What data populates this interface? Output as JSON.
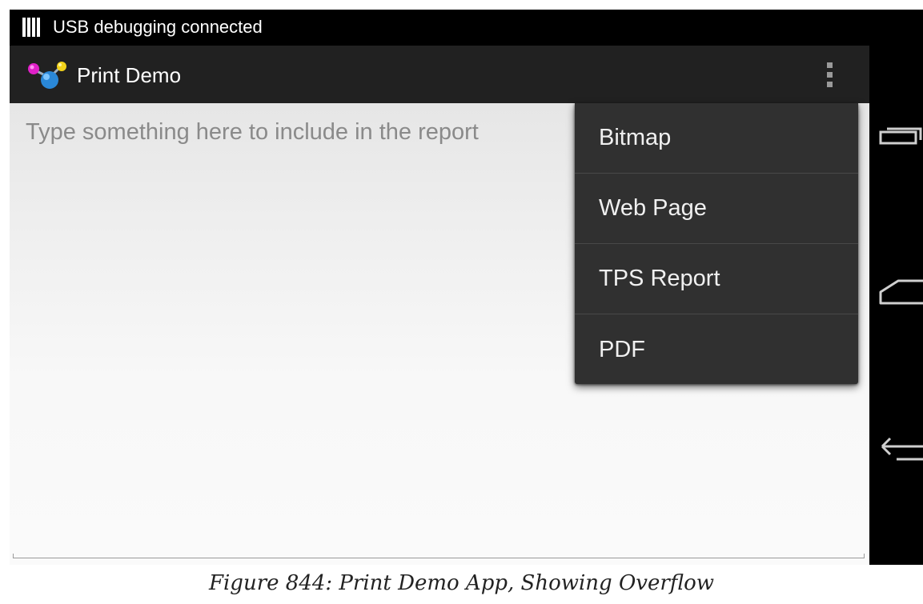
{
  "status_bar": {
    "icon": "usb-debugging-icon",
    "text": "USB debugging connected"
  },
  "action_bar": {
    "app_icon": "app-molecule-icon",
    "title": "Print Demo",
    "overflow_icon": "overflow-menu-icon"
  },
  "content": {
    "edit_placeholder": "Type something here to include in the report"
  },
  "overflow_menu": {
    "items": [
      {
        "label": "Bitmap"
      },
      {
        "label": "Web Page"
      },
      {
        "label": "TPS Report"
      },
      {
        "label": "PDF"
      }
    ]
  },
  "nav_bar": {
    "recents_icon": "recents-icon",
    "home_icon": "home-icon",
    "back_icon": "back-icon"
  },
  "caption": {
    "text": "Figure 844: Print Demo App, Showing Overflow"
  },
  "colors": {
    "status_bar": "#000000",
    "action_bar": "#212121",
    "menu_bg": "#303030",
    "menu_text": "#f0f0f0",
    "placeholder": "#8a8a8a"
  }
}
